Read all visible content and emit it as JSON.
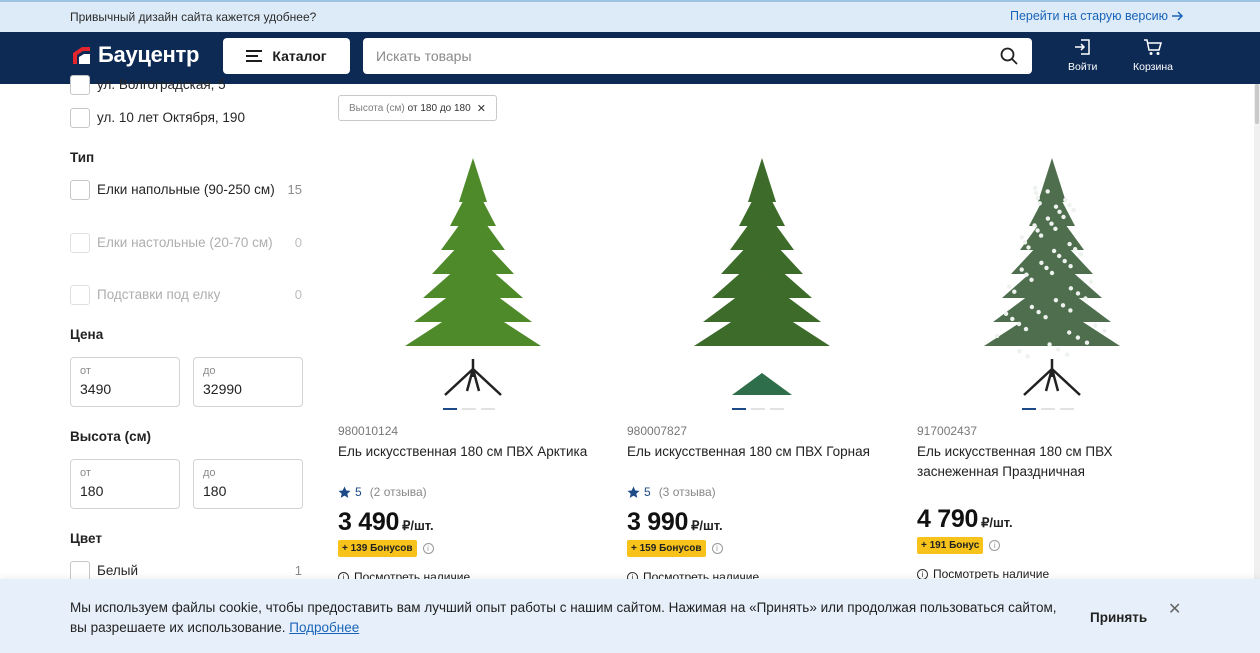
{
  "topbar": {
    "message": "Привычный дизайн сайта кажется удобнее?",
    "old_version_link": "Перейти на старую версию"
  },
  "header": {
    "logo_text": "Бауцентр",
    "catalog_label": "Каталог",
    "search_placeholder": "Искать товары",
    "login_label": "Войти",
    "cart_label": "Корзина"
  },
  "sidebar": {
    "stores": [
      {
        "label": "ул. Волгоградская, 5"
      },
      {
        "label": "ул. 10 лет Октября, 190"
      }
    ],
    "type_title": "Тип",
    "types": [
      {
        "label": "Елки напольные (90-250 см)",
        "count": "15",
        "disabled": false
      },
      {
        "label": "Елки настольные (20-70 см)",
        "count": "0",
        "disabled": true
      },
      {
        "label": "Подставки под елку",
        "count": "0",
        "disabled": true
      }
    ],
    "price_title": "Цена",
    "price_from_label": "от",
    "price_from": "3490",
    "price_to_label": "до",
    "price_to": "32990",
    "height_title": "Высота (см)",
    "height_from_label": "от",
    "height_from": "180",
    "height_to_label": "до",
    "height_to": "180",
    "color_title": "Цвет",
    "colors": [
      {
        "label": "Белый",
        "count": "1"
      }
    ]
  },
  "filter_chip": {
    "name": "Высота (см)",
    "value": "от 180 до 180",
    "remove": "✕"
  },
  "products": [
    {
      "sku": "980010124",
      "title": "Ель искусственная 180 см ПВХ Арктика",
      "rating": "5",
      "reviews": "(2 отзыва)",
      "price": "3 490",
      "unit": "₽/шт.",
      "bonus": "+ 139 Бонусов",
      "stock": "Посмотреть наличие",
      "tree_color": "#4f8a2a",
      "stand": "black"
    },
    {
      "sku": "980007827",
      "title": "Ель искусственная 180 см ПВХ Горная",
      "rating": "5",
      "reviews": "(3 отзыва)",
      "price": "3 990",
      "unit": "₽/шт.",
      "bonus": "+ 159 Бонусов",
      "stock": "Посмотреть наличие",
      "tree_color": "#3d6b2a",
      "stand": "green"
    },
    {
      "sku": "917002437",
      "title": "Ель искусственная 180 см ПВХ заснеженная Праздничная",
      "rating": "",
      "reviews": "",
      "price": "4 790",
      "unit": "₽/шт.",
      "bonus": "+ 191 Бонус",
      "stock": "Посмотреть наличие",
      "tree_color": "#4e6e4e",
      "stand": "black"
    }
  ],
  "cookie": {
    "text": "Мы используем файлы cookie, чтобы предоставить вам лучший опыт работы с нашим сайтом. Нажимая на «Принять» или продолжая пользоваться сайтом, вы разрешаете их использование. ",
    "more_link": "Подробнее",
    "accept_label": "Принять",
    "close": "✕"
  },
  "colors": {
    "header_bg": "#0d2a54",
    "topbar_bg": "#dcebf7",
    "link": "#1a64b8",
    "bonus_bg": "#f7c21a",
    "logo_red": "#e3262e"
  }
}
